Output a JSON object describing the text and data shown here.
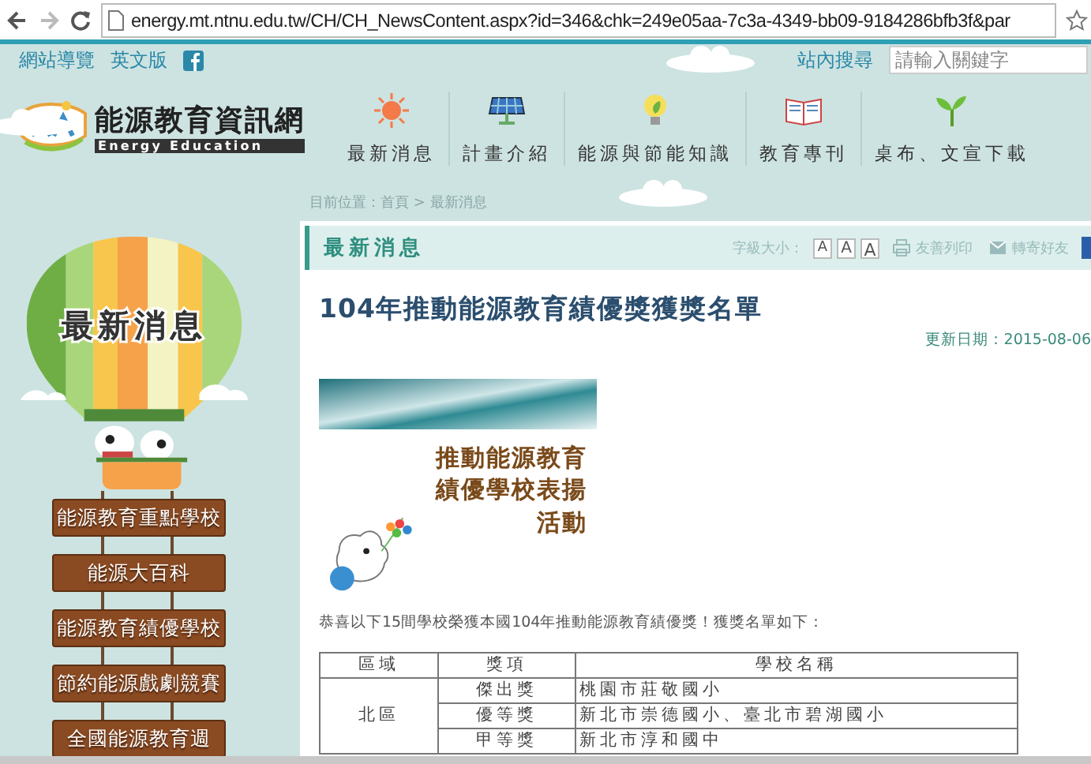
{
  "browser": {
    "url": "energy.mt.ntnu.edu.tw/CH/CH_NewsContent.aspx?id=346&chk=249e05aa-7c3a-4349-bb09-9184286bfb3f&par"
  },
  "top_links": [
    {
      "label": "網站導覽"
    },
    {
      "label": "英文版"
    }
  ],
  "search": {
    "label": "站內搜尋",
    "placeholder": "請輸入關鍵字"
  },
  "logo": {
    "title": "能源教育資訊網",
    "subtitle": "Energy Education"
  },
  "nav": [
    {
      "label": "最新消息",
      "kind": "sun"
    },
    {
      "label": "計畫介紹",
      "kind": "solar"
    },
    {
      "label": "能源與節能知識",
      "kind": "bulb"
    },
    {
      "label": "教育專刊",
      "kind": "book"
    },
    {
      "label": "桌布、文宣下載",
      "kind": "sprout"
    }
  ],
  "breadcrumb": "目前位置：首頁 > 最新消息",
  "sidebar": {
    "balloon_title": "最新消息",
    "items": [
      {
        "label": "能源教育重點學校"
      },
      {
        "label": "能源大百科"
      },
      {
        "label": "能源教育績優學校"
      },
      {
        "label": "節約能源戲劇競賽"
      },
      {
        "label": "全國能源教育週"
      }
    ]
  },
  "section": {
    "title": "最新消息",
    "font_size_label": "字級大小：",
    "font_sizes": [
      "A",
      "A",
      "A"
    ],
    "actions": [
      {
        "label": "友善列印",
        "kind": "print"
      },
      {
        "label": "轉寄好友",
        "kind": "mail"
      }
    ]
  },
  "article": {
    "title": "104年推動能源教育績優獎獲獎名單",
    "updated": "更新日期：2015-08-06",
    "banner_lines": [
      "推動能源教育",
      "績優學校表揚",
      "活動"
    ],
    "intro": "恭喜以下15間學校榮獲本國104年推動能源教育績優獎！獲獎名單如下：",
    "table": {
      "columns": [
        "區域",
        "獎項",
        "學校名稱"
      ],
      "groups": [
        {
          "region": "北區",
          "rows": [
            {
              "award": "傑出獎",
              "schools": "桃園市莊敬國小"
            },
            {
              "award": "優等獎",
              "schools": "新北市崇德國小、臺北市碧湖國小"
            },
            {
              "award": "甲等獎",
              "schools": "新北市淳和國中"
            }
          ]
        }
      ]
    }
  }
}
